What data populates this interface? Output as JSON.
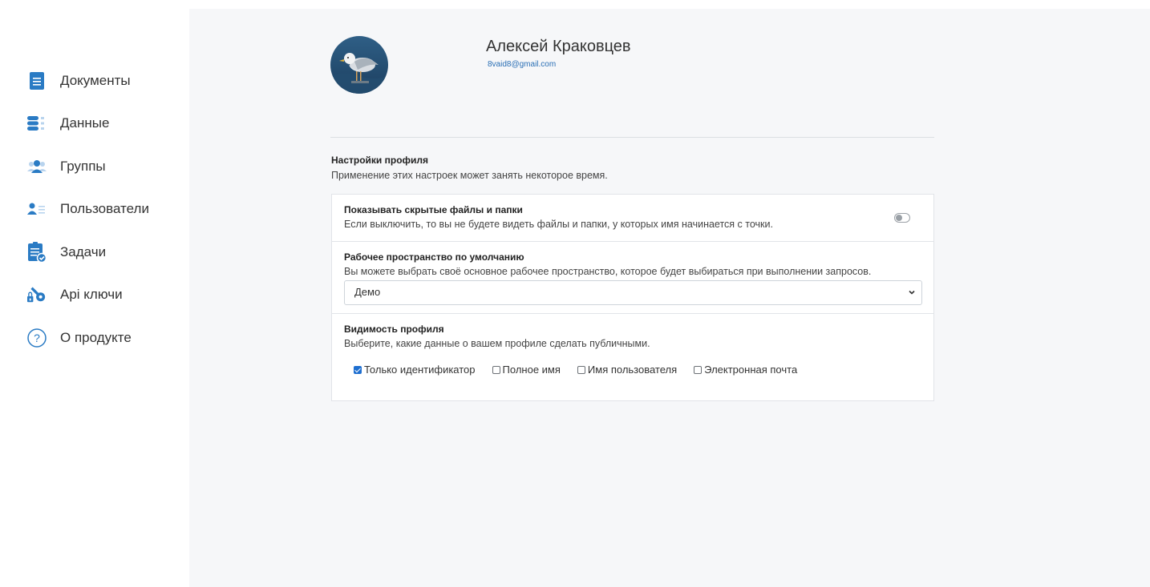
{
  "sidebar": {
    "items": [
      {
        "label": "Документы",
        "icon": "document-icon"
      },
      {
        "label": "Данные",
        "icon": "database-icon"
      },
      {
        "label": "Группы",
        "icon": "group-icon"
      },
      {
        "label": "Пользователи",
        "icon": "users-list-icon"
      },
      {
        "label": "Задачи",
        "icon": "clipboard-check-icon"
      },
      {
        "label": "Api ключи",
        "icon": "key-icon"
      },
      {
        "label": "О продукте",
        "icon": "question-circle-icon"
      }
    ]
  },
  "profile": {
    "name": "Алексей Краковцев",
    "email": "8vaid8@gmail.com"
  },
  "settings": {
    "title": "Настройки профиля",
    "description": "Применение этих настроек может занять некоторое время.",
    "hidden_files": {
      "title": "Показывать скрытые файлы и папки",
      "description": "Если выключить, то вы не будете видеть файлы и папки, у которых имя начинается с точки.",
      "enabled": false
    },
    "workspace": {
      "title": "Рабочее пространство по умолчанию",
      "description": "Вы можете выбрать своё основное рабочее пространство, которое будет выбираться при выполнении запросов.",
      "selected": "Демо"
    },
    "visibility": {
      "title": "Видимость профиля",
      "description": "Выберите, какие данные о вашем профиле сделать публичными.",
      "options": [
        {
          "label": "Только идентификатор",
          "checked": true
        },
        {
          "label": "Полное имя",
          "checked": false
        },
        {
          "label": "Имя пользователя",
          "checked": false
        },
        {
          "label": "Электронная почта",
          "checked": false
        }
      ]
    }
  },
  "colors": {
    "accent": "#2a7bc4",
    "main_bg": "#f6f7f9"
  }
}
